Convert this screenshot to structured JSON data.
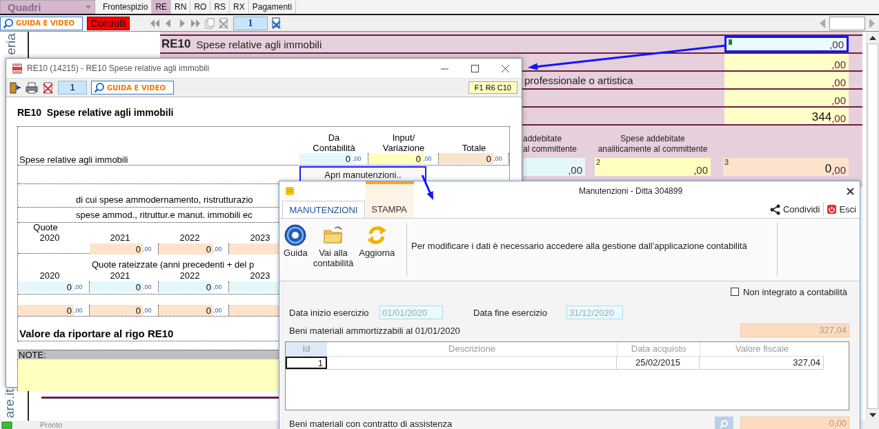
{
  "tabbar": {
    "dropdown": "Quadri",
    "tabs": [
      {
        "label": "Frontespizio",
        "selected": false
      },
      {
        "label": "RE",
        "selected": true
      },
      {
        "label": "RN",
        "selected": false
      },
      {
        "label": "RO",
        "selected": false
      },
      {
        "label": "RS",
        "selected": false
      },
      {
        "label": "RX",
        "selected": false
      },
      {
        "label": "Pagamenti",
        "selected": false
      }
    ]
  },
  "toolbar": {
    "guide_button": "GUIDA E VIDEO",
    "controls_button": "Controlli",
    "page": "1"
  },
  "form": {
    "side_texts": [
      "eria",
      "are.it"
    ],
    "lines": [
      {
        "code": "RE10",
        "label": "Spese relative agli immobili",
        "cents": ",00",
        "highlighted": true
      },
      {
        "cents": ",00",
        "highlighted": false
      },
      {
        "label": "professionale o artistica",
        "cents": ",00",
        "highlighted": false
      },
      {
        "cents": ",00",
        "highlighted": false
      },
      {
        "value": "344",
        "cents": ",00",
        "highlighted": false
      }
    ],
    "columns": [
      {
        "heading": "addebitate\nal committente",
        "kind": "accounting",
        "cents": ",00"
      },
      {
        "heading": "Spese addebitate\nanaliticamente al committente",
        "number": "2",
        "kind": "input",
        "cents": ",00"
      },
      {
        "number": "3",
        "kind": "total",
        "value": "0",
        "cents": ",00"
      }
    ]
  },
  "status_bar": {
    "text": "Pronto"
  },
  "dialog": {
    "title": "RE10 (14215) - RE10 Spese relative agli immobili",
    "page": "1",
    "guide_button": "GUIDA E VIDEO",
    "position": "F1 R6 C10",
    "heading": "RE10  Spese relative agli immobili",
    "columns": [
      "Da\nContabilità",
      "Input/\nVariazione",
      "Totale"
    ],
    "main_row": {
      "label": "Spese relative agli immobili",
      "fields": [
        {
          "kind": "accounting",
          "value": "0",
          "cents": ",00"
        },
        {
          "kind": "input",
          "value": "0",
          "cents": ",00"
        },
        {
          "kind": "total",
          "value": "0",
          "cents": ",00"
        }
      ]
    },
    "open_button": "Apri manutenzioni..",
    "sub_rows": [
      "di cui spese ammodernamento, ristrutturazio",
      "spese ammod., ritruttur.e manut. immobili ec"
    ],
    "quote_label": "Quote",
    "quote_years": [
      "2020",
      "2021",
      "2022",
      "2023"
    ],
    "quote_fields": [
      {
        "kind": "none"
      },
      {
        "kind": "total",
        "value": "0",
        "cents": ",00"
      },
      {
        "kind": "total",
        "value": "0",
        "cents": ",00"
      },
      {
        "kind": "total"
      }
    ],
    "rateized_label": "Quote rateizzate (anni precedenti + del p",
    "rateized_years": [
      "2020",
      "2021",
      "2022",
      "2023"
    ],
    "rateized_rows": [
      [
        {
          "kind": "accounting",
          "value": "0",
          "cents": ",00"
        },
        {
          "kind": "accounting",
          "value": "0",
          "cents": ",00"
        },
        {
          "kind": "accounting",
          "value": "0",
          "cents": ",00"
        },
        {
          "kind": "accounting"
        }
      ],
      [
        {
          "kind": "total",
          "value": "0",
          "cents": ",00"
        },
        {
          "kind": "total",
          "value": "0",
          "cents": ",00"
        },
        {
          "kind": "total",
          "value": "0",
          "cents": ",00"
        },
        {
          "kind": "total"
        }
      ]
    ],
    "total_label": "Valore da riportare al rigo RE10",
    "notes_label": "NOTE:"
  },
  "manutenzioni": {
    "title": "Manutenzioni - Ditta 304899",
    "tabs": [
      {
        "label": "MANUTENZIONI",
        "selected": true
      },
      {
        "label": "STAMPA",
        "selected": false
      }
    ],
    "share": "Condividi",
    "exit": "Esci",
    "ribbon": [
      {
        "label": "Guida",
        "kind": "help"
      },
      {
        "label": "Vai alla\ncontabilità",
        "kind": "folder"
      },
      {
        "label": "Aggiorna",
        "kind": "refresh"
      }
    ],
    "message": "Per modificare i dati è necessario accedere alla gestione dall'applicazione contabilità",
    "not_integrated": {
      "label": "Non integrato a contabilità",
      "checked": false
    },
    "start_label": "Data inizio esercizio",
    "start": "01/01/2020",
    "end_label": "Data fine esercizio",
    "end": "31/12/2020",
    "assets_label": "Beni materiali ammortizzabili al 01/01/2020",
    "assets_total": "327,04",
    "grid": {
      "columns": [
        "Id",
        "Descrizione",
        "Data acquisto",
        "Valore fiscale"
      ],
      "rows": [
        {
          "id": "1",
          "date": "25/02/2015",
          "value": "327,04",
          "selected": true
        }
      ]
    },
    "assistance_label": "Beni materiali con contratto di assistenza",
    "assistance_total": "0,00"
  }
}
